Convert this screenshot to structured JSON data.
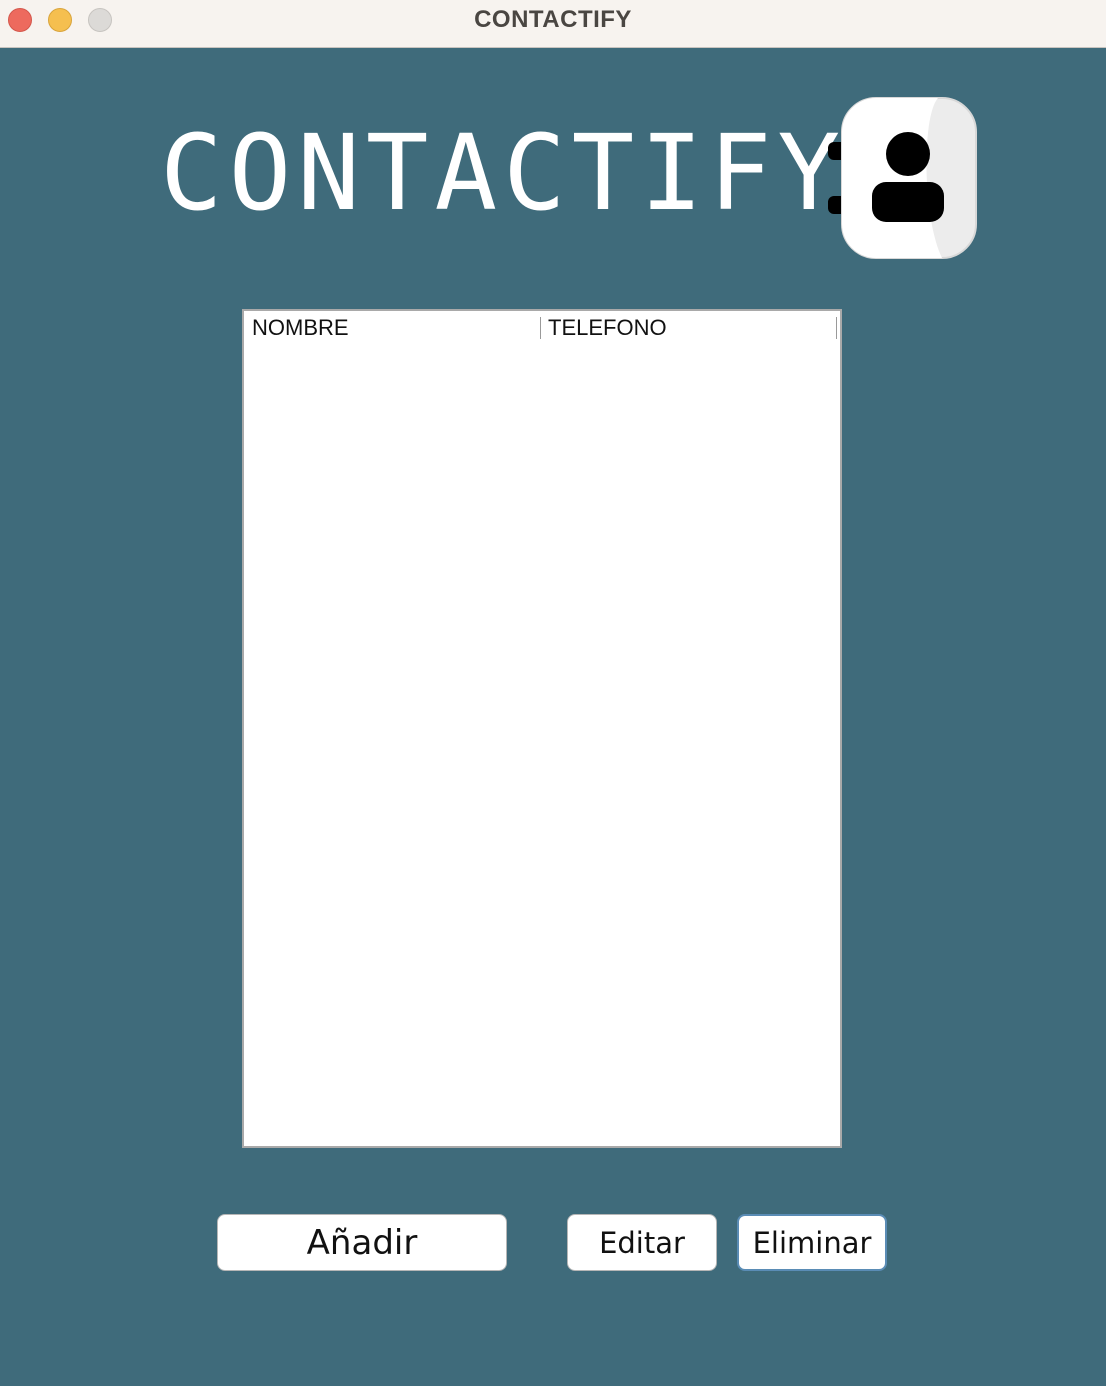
{
  "window": {
    "title": "CONTACTIFY"
  },
  "header": {
    "app_title": "CONTACTIFY",
    "icon": "contact-book-icon"
  },
  "table": {
    "columns": [
      "NOMBRE",
      "TELEFONO"
    ],
    "rows": []
  },
  "actions": {
    "add_label": "Añadir",
    "edit_label": "Editar",
    "delete_label": "Eliminar"
  },
  "colors": {
    "background": "#3f6b7b",
    "titlebar": "#f7f3ef",
    "close": "#ed6a5e",
    "minimize": "#f5bf4f",
    "zoom": "#dcdad7"
  }
}
